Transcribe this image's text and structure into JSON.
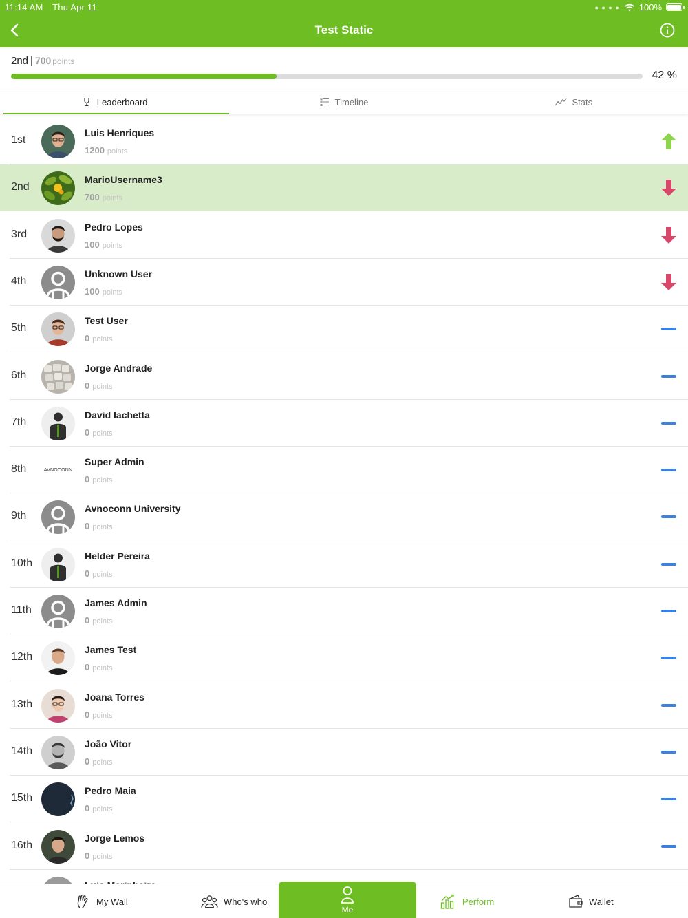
{
  "status_bar": {
    "time": "11:14 AM",
    "date": "Thu Apr 11",
    "battery": "100%"
  },
  "nav": {
    "title": "Test Static"
  },
  "progress": {
    "rank": "2nd",
    "separator": "|",
    "points": "700",
    "points_label": "points",
    "percent": 42,
    "percent_text": "42 %"
  },
  "tabs": [
    {
      "label": "Leaderboard",
      "icon": "trophy-icon",
      "active": true
    },
    {
      "label": "Timeline",
      "icon": "list-icon",
      "active": false
    },
    {
      "label": "Stats",
      "icon": "chart-line-icon",
      "active": false
    }
  ],
  "colors": {
    "brand": "#6dbd23",
    "up": "#8fd44f",
    "down": "#d9486b",
    "same": "#3b82e0",
    "highlight": "#d9ecca"
  },
  "points_label": "points",
  "leaderboard": [
    {
      "rank": "1st",
      "name": "Luis Henriques",
      "points": "1200",
      "trend": "up",
      "avatar": "photo-man-glasses"
    },
    {
      "rank": "2nd",
      "name": "MarioUsername3",
      "points": "700",
      "trend": "down",
      "avatar": "photo-plant",
      "current": true
    },
    {
      "rank": "3rd",
      "name": "Pedro Lopes",
      "points": "100",
      "trend": "down",
      "avatar": "photo-bearded-man"
    },
    {
      "rank": "4th",
      "name": "Unknown User",
      "points": "100",
      "trend": "down",
      "avatar": "default-user"
    },
    {
      "rank": "5th",
      "name": "Test User",
      "points": "0",
      "trend": "same",
      "avatar": "photo-man-glasses-red"
    },
    {
      "rank": "6th",
      "name": "Jorge Andrade",
      "points": "0",
      "trend": "same",
      "avatar": "photo-keyboard"
    },
    {
      "rank": "7th",
      "name": "David Iachetta",
      "points": "0",
      "trend": "same",
      "avatar": "silhouette"
    },
    {
      "rank": "8th",
      "name": "Super Admin",
      "points": "0",
      "trend": "same",
      "avatar": "avnoconn-logo",
      "logo_text": "AVNOCONN"
    },
    {
      "rank": "9th",
      "name": "Avnoconn University",
      "points": "0",
      "trend": "same",
      "avatar": "default-user"
    },
    {
      "rank": "10th",
      "name": "Helder Pereira",
      "points": "0",
      "trend": "same",
      "avatar": "silhouette"
    },
    {
      "rank": "11th",
      "name": "James Admin",
      "points": "0",
      "trend": "same",
      "avatar": "default-user"
    },
    {
      "rank": "12th",
      "name": "James Test",
      "points": "0",
      "trend": "same",
      "avatar": "photo-suit-man"
    },
    {
      "rank": "13th",
      "name": "Joana Torres",
      "points": "0",
      "trend": "same",
      "avatar": "photo-woman-glasses"
    },
    {
      "rank": "14th",
      "name": "João Vitor",
      "points": "0",
      "trend": "same",
      "avatar": "photo-man-bw"
    },
    {
      "rank": "15th",
      "name": "Pedro Maia",
      "points": "0",
      "trend": "same",
      "avatar": "photo-dark"
    },
    {
      "rank": "16th",
      "name": "Jorge Lemos",
      "points": "0",
      "trend": "same",
      "avatar": "photo-man-dark-hair"
    },
    {
      "rank": "",
      "name": "Luis Marinheiro",
      "points": "",
      "trend": "",
      "avatar": "photo-partial"
    }
  ],
  "bottom_nav": [
    {
      "label": "My Wall",
      "icon": "hand-icon"
    },
    {
      "label": "Who's who",
      "icon": "people-icon"
    },
    {
      "label": "Me",
      "icon": "user-icon",
      "active": true
    },
    {
      "label": "Perform",
      "icon": "bar-chart-icon"
    },
    {
      "label": "Wallet",
      "icon": "wallet-icon"
    }
  ]
}
